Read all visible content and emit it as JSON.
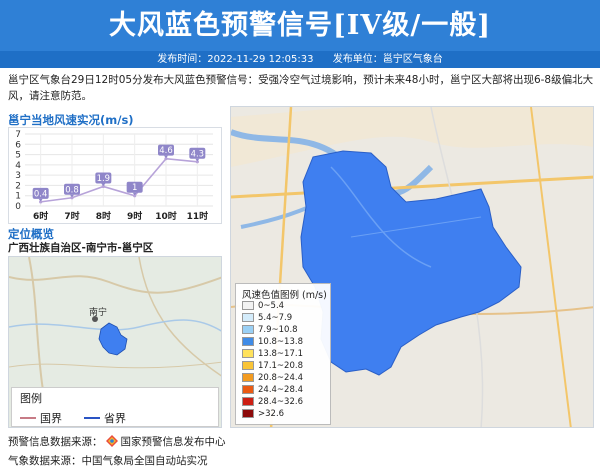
{
  "header": {
    "title": "大风蓝色预警信号[IV级/一般]",
    "publish_time": "发布时间：2022-11-29 12:05:33",
    "publisher": "发布单位：邕宁区气象台"
  },
  "description": "邕宁区气象台29日12时05分发布大风蓝色预警信号：受强冷空气过境影响，预计未来48小时，邕宁区大部将出现6-8级偏北大风，请注意防范。",
  "wind_panel": {
    "title": "邕宁当地风速实况(m/s)"
  },
  "chart_data": {
    "type": "line",
    "categories": [
      "6时",
      "7时",
      "8时",
      "9时",
      "10时",
      "11时"
    ],
    "values": [
      0.4,
      0.8,
      1.9,
      1,
      4.6,
      4.3
    ],
    "ylim": [
      0,
      7
    ],
    "yticks": [
      0,
      1,
      2,
      3,
      4,
      5,
      6,
      7
    ],
    "title": "邕宁当地风速实况(m/s)",
    "grid": true,
    "color": "#b7a3d9",
    "label_bg": "#8f86c9"
  },
  "location": {
    "title": "定位概览",
    "path": "广西壮族自治区-南宁市-邕宁区",
    "city_label": "南宁",
    "legend_title": "图例",
    "legend_items": [
      {
        "label": "国界",
        "color": "#c77b86"
      },
      {
        "label": "省界",
        "color": "#2a54c4"
      }
    ]
  },
  "wind_legend": {
    "title": "风速色值图例 (m/s)",
    "items": [
      {
        "label": "0~5.4",
        "color": "#f2f2f2"
      },
      {
        "label": "5.4~7.9",
        "color": "#d4ecfb"
      },
      {
        "label": "7.9~10.8",
        "color": "#9ad0f5"
      },
      {
        "label": "10.8~13.8",
        "color": "#3f8be6"
      },
      {
        "label": "13.8~17.1",
        "color": "#ffe25c"
      },
      {
        "label": "17.1~20.8",
        "color": "#f9c436"
      },
      {
        "label": "20.8~24.4",
        "color": "#f39b20"
      },
      {
        "label": "24.4~28.4",
        "color": "#ea5b14"
      },
      {
        "label": "28.4~32.6",
        "color": "#cc1f14"
      },
      {
        "label": ">32.6",
        "color": "#8c0a0a"
      }
    ]
  },
  "footer": {
    "source_label": "预警信息数据来源：",
    "source_name": "国家预警信息发布中心",
    "weather_source": "气象数据来源：中国气象局全国自动站实况"
  },
  "colors": {
    "header_bg": "#2f80d6",
    "subbar_bg": "#1f6fc6",
    "region_fill": "#3f7ff0"
  }
}
